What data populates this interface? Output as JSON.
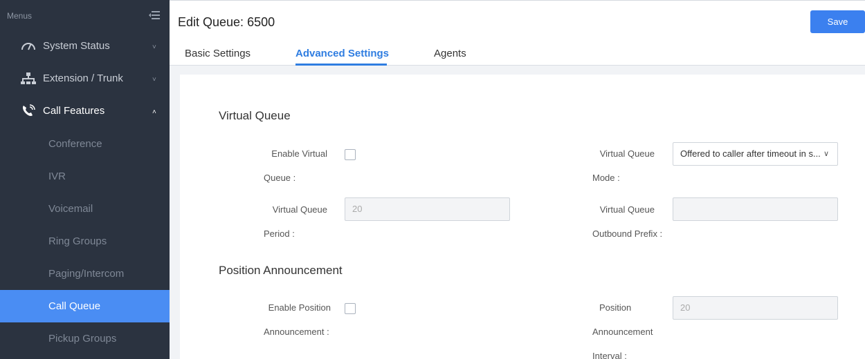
{
  "sidebar": {
    "header": "Menus",
    "items": [
      {
        "label": "System Status",
        "icon": "gauge-icon",
        "chevron": "˅"
      },
      {
        "label": "Extension / Trunk",
        "icon": "network-icon",
        "chevron": "˅"
      },
      {
        "label": "Call Features",
        "icon": "phone-icon",
        "chevron": "˄"
      }
    ],
    "subitems": [
      {
        "label": "Conference"
      },
      {
        "label": "IVR"
      },
      {
        "label": "Voicemail"
      },
      {
        "label": "Ring Groups"
      },
      {
        "label": "Paging/Intercom"
      },
      {
        "label": "Call Queue"
      },
      {
        "label": "Pickup Groups"
      }
    ]
  },
  "header": {
    "title": "Edit Queue: 6500",
    "save_label": "Save"
  },
  "tabs": [
    {
      "label": "Basic Settings"
    },
    {
      "label": "Advanced Settings"
    },
    {
      "label": "Agents"
    }
  ],
  "form": {
    "virtual_queue": {
      "title": "Virtual Queue",
      "enable_label_1": "Enable Virtual",
      "enable_label_2": "Queue :",
      "mode_label_1": "Virtual Queue",
      "mode_label_2": "Mode :",
      "mode_value": "Offered to caller after timeout in s...",
      "period_label_1": "Virtual Queue",
      "period_label_2": "Period :",
      "period_value": "20",
      "prefix_label_1": "Virtual Queue",
      "prefix_label_2": "Outbound Prefix :",
      "prefix_value": ""
    },
    "position_announcement": {
      "title": "Position Announcement",
      "enable_label_1": "Enable Position",
      "enable_label_2": "Announcement :",
      "interval_label_1": "Position",
      "interval_label_2": "Announcement",
      "interval_label_3": "Interval :",
      "interval_value": "20"
    }
  },
  "colors": {
    "sidebar_bg": "#2b3340",
    "active_item": "#4a8df3",
    "accent": "#2f7de1",
    "save_button": "#3b80ef"
  }
}
